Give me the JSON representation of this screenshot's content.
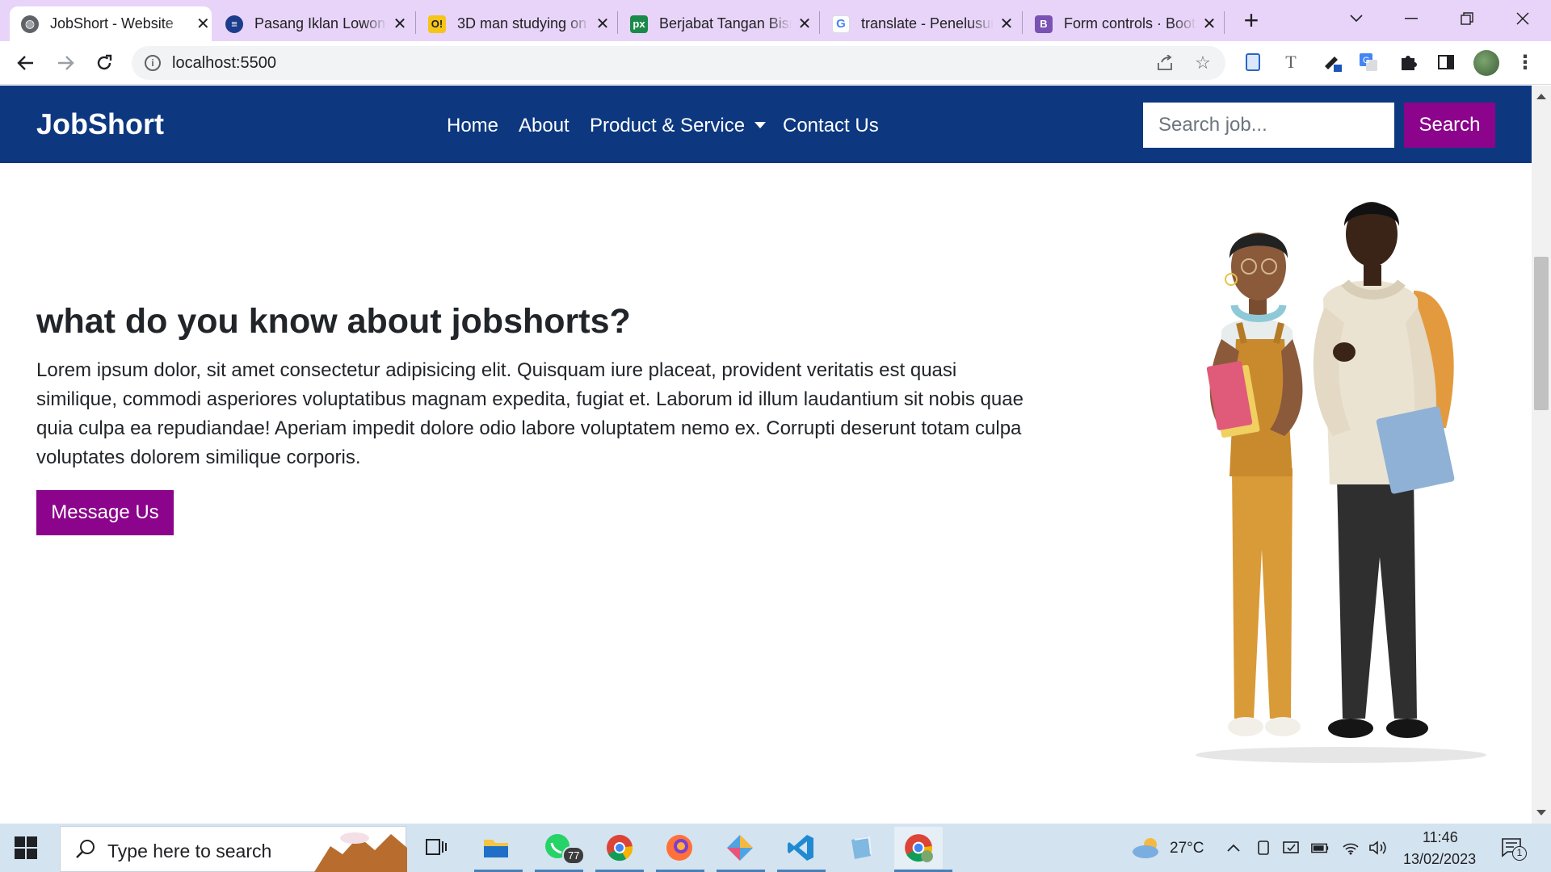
{
  "browser": {
    "tabs": [
      {
        "title": "JobShort - Website",
        "icon": "globe-icon",
        "active": true
      },
      {
        "title": "Pasang Iklan Lowongan",
        "icon": "site-icon"
      },
      {
        "title": "3D man studying on",
        "icon": "o-icon"
      },
      {
        "title": "Berjabat Tangan Bisnis",
        "icon": "px-icon"
      },
      {
        "title": "translate - Penelusuran",
        "icon": "google-icon"
      },
      {
        "title": "Form controls · Bootstrap",
        "icon": "bootstrap-icon"
      }
    ],
    "tab_close": "✕",
    "new_tab": "+",
    "url": "localhost:5500"
  },
  "site": {
    "brand": "JobShort",
    "nav": {
      "home": "Home",
      "about": "About",
      "products": "Product & Service",
      "contact": "Contact Us"
    },
    "search": {
      "placeholder": "Search job...",
      "button": "Search"
    },
    "hero": {
      "heading": "what do you know about jobshorts?",
      "text": "Lorem ipsum dolor, sit amet consectetur adipisicing elit. Quisquam iure placeat, provident veritatis est quasi similique, commodi asperiores voluptatibus magnam expedita, fugiat et. Laborum id illum laudantium sit nobis quae quia culpa ea repudiandae! Aperiam impedit dolore odio labore voluptatem nemo ex. Corrupti deserunt totam culpa voluptates dolorem similique corporis.",
      "button": "Message Us"
    }
  },
  "taskbar": {
    "search_placeholder": "Type here to search",
    "whatsapp_badge": "77",
    "weather": "27°C",
    "time": "11:46",
    "date": "13/02/2023",
    "notifications": "1"
  },
  "colors": {
    "navbar": "#0d3880",
    "accent": "#8b048b",
    "tabstrip": "#e8d4f8"
  }
}
